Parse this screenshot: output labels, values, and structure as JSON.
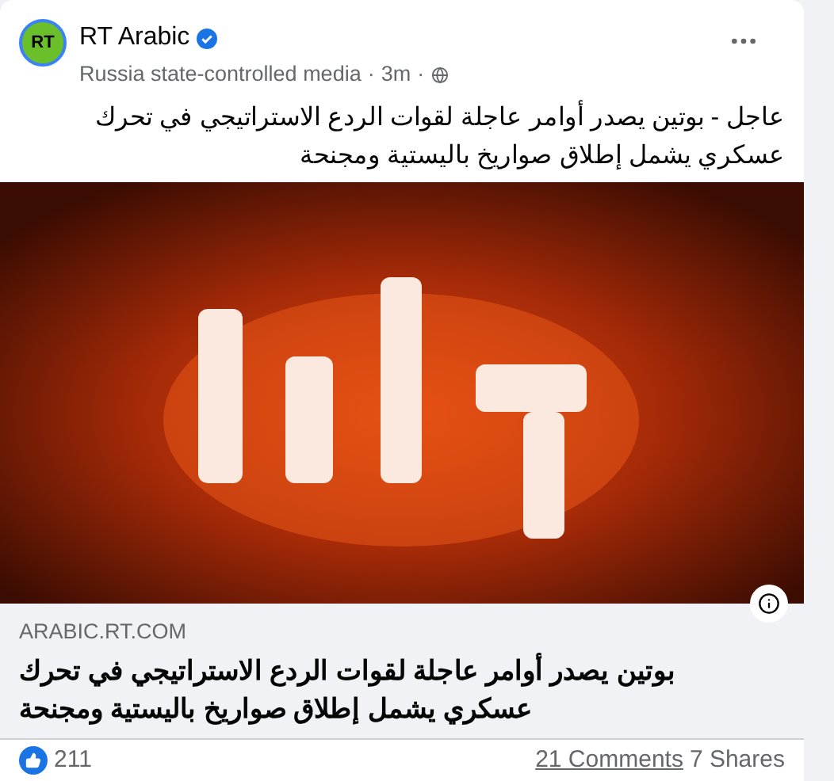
{
  "post": {
    "avatar_text": "RT",
    "author": "RT Arabic",
    "verified": true,
    "label": "Russia state-controlled media",
    "separator": "·",
    "time": "3m",
    "text": "عاجل - بوتين يصدر أوامر عاجلة لقوات الردع الاستراتيجي في تحرك عسكري يشمل إطلاق صواريخ باليستية ومجنحة"
  },
  "link_preview": {
    "domain": "ARABIC.RT.COM",
    "title": "بوتين يصدر أوامر عاجلة لقوات الردع الاستراتيجي في تحرك عسكري يشمل إطلاق صواريخ باليستية ومجنحة"
  },
  "footer": {
    "reactions": "211",
    "comments": "21 Comments",
    "shares": "7 Shares"
  }
}
